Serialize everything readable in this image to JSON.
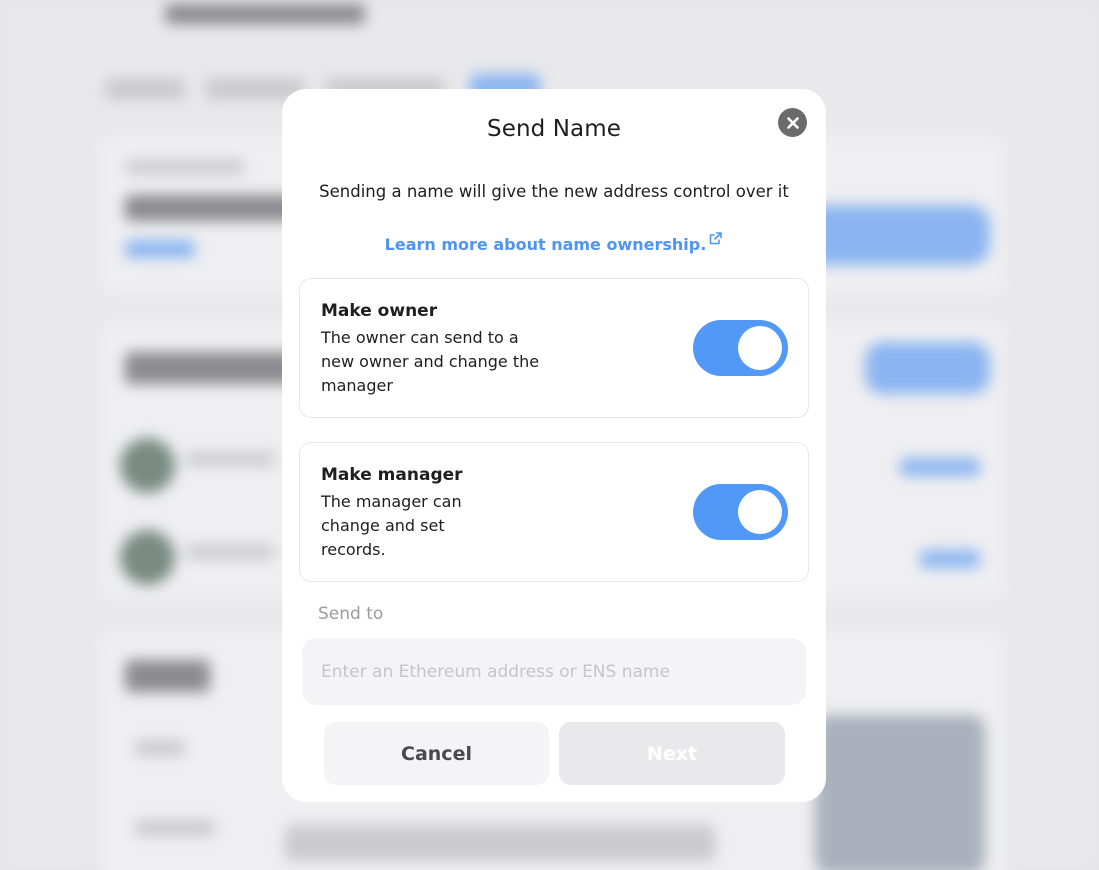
{
  "modal": {
    "title": "Send Name",
    "subtitle": "Sending a name will give the new address control over it",
    "learn_link": "Learn more about name ownership.",
    "options": [
      {
        "title": "Make owner",
        "description_lines": [
          "The owner can send to a",
          "new owner and change the",
          "manager"
        ],
        "enabled": true
      },
      {
        "title": "Make manager",
        "description_lines": [
          "The manager can",
          "change and set",
          "records."
        ],
        "enabled": true
      }
    ],
    "send_to": {
      "label": "Send to",
      "placeholder": "Enter an Ethereum address or ENS name",
      "value": ""
    },
    "buttons": {
      "cancel": "Cancel",
      "next": "Next"
    }
  },
  "colors": {
    "accent": "#5198f7",
    "link": "#4f94f2",
    "close_button": "#6b6b6b",
    "disabled_button": "#e9e9ec"
  },
  "icons": [
    "close-icon",
    "external-link-icon"
  ]
}
